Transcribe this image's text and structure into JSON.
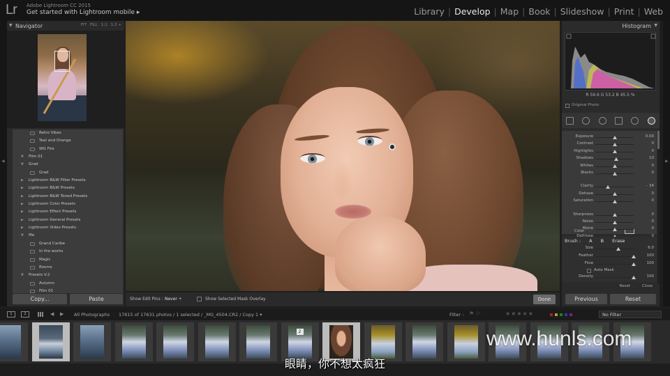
{
  "app": {
    "logo": "Lr",
    "name": "Adobe Lightroom CC 2015",
    "identity": "Get started with Lightroom mobile ▸"
  },
  "modules": [
    "Library",
    "Develop",
    "Map",
    "Book",
    "Slideshow",
    "Print",
    "Web"
  ],
  "active_module": "Develop",
  "navigator": {
    "title": "Navigator",
    "modes": [
      "FIT",
      "FILL",
      "1:1",
      "1:2 ÷"
    ]
  },
  "presets": [
    {
      "kind": "item",
      "label": "Retro Vibes"
    },
    {
      "kind": "item",
      "label": "Teal and Orange"
    },
    {
      "kind": "item",
      "label": "WG Fire"
    },
    {
      "kind": "folder",
      "open": true,
      "label": "Film 01"
    },
    {
      "kind": "folder",
      "open": true,
      "label": "Grad"
    },
    {
      "kind": "item",
      "label": "Grad"
    },
    {
      "kind": "folder",
      "open": false,
      "label": "Lightroom B&W Filter Presets"
    },
    {
      "kind": "folder",
      "open": false,
      "label": "Lightroom B&W Presets"
    },
    {
      "kind": "folder",
      "open": false,
      "label": "Lightroom B&W Toned Presets"
    },
    {
      "kind": "folder",
      "open": false,
      "label": "Lightroom Color Presets"
    },
    {
      "kind": "folder",
      "open": false,
      "label": "Lightroom Effect Presets"
    },
    {
      "kind": "folder",
      "open": false,
      "label": "Lightroom General Presets"
    },
    {
      "kind": "folder",
      "open": false,
      "label": "Lightroom Video Presets"
    },
    {
      "kind": "folder",
      "open": true,
      "label": "Me"
    },
    {
      "kind": "item",
      "label": "Grand Caribe"
    },
    {
      "kind": "item",
      "label": "In the works"
    },
    {
      "kind": "item",
      "label": "Magic"
    },
    {
      "kind": "item",
      "label": "Rooms"
    },
    {
      "kind": "folder",
      "open": true,
      "label": "Presets V.2"
    },
    {
      "kind": "item",
      "label": "Autumn"
    },
    {
      "kind": "item",
      "label": "Film 01"
    }
  ],
  "left_buttons": {
    "copy": "Copy...",
    "paste": "Paste"
  },
  "toolbar": {
    "edit_pins_label": "Show Edit Pins :",
    "edit_pins_value": "Never ÷",
    "mask_overlay_label": "Show Selected Mask Overlay",
    "done": "Done"
  },
  "histogram": {
    "title": "Histogram",
    "readout": "R  59.6  G  53.2  B  45.5 %",
    "original_photo": "Original Photo"
  },
  "adjustments": [
    {
      "label": "Exposure",
      "value": "0.00",
      "pos": 0.5
    },
    {
      "label": "Contrast",
      "value": "0",
      "pos": 0.5
    },
    {
      "label": "Highlights",
      "value": "0",
      "pos": 0.5
    },
    {
      "label": "Shadows",
      "value": "10",
      "pos": 0.55
    },
    {
      "label": "Whites",
      "value": "0",
      "pos": 0.5
    },
    {
      "label": "Blacks",
      "value": "0",
      "pos": 0.5
    },
    {
      "label": "Clarity",
      "value": "- 34",
      "pos": 0.33
    },
    {
      "label": "Dehaze",
      "value": "0",
      "pos": 0.5
    },
    {
      "label": "Saturation",
      "value": "0",
      "pos": 0.5
    },
    {
      "label": "Sharpness",
      "value": "0",
      "pos": 0.5
    },
    {
      "label": "Noise",
      "value": "0",
      "pos": 0.5
    },
    {
      "label": "Moiré",
      "value": "0",
      "pos": 0.5
    },
    {
      "label": "Defringe",
      "value": "0",
      "pos": 0.5
    }
  ],
  "color_label": "Color",
  "brush": {
    "label": "Brush :",
    "tabs": [
      "A",
      "B",
      "Erase"
    ],
    "sliders": [
      {
        "label": "Size",
        "value": "6.0",
        "pos": 0.6
      },
      {
        "label": "Feather",
        "value": "100",
        "pos": 1.0
      },
      {
        "label": "Flow",
        "value": "100",
        "pos": 1.0
      },
      {
        "label": "Density",
        "value": "100",
        "pos": 1.0
      }
    ],
    "auto_mask": "Auto Mask",
    "reset": "Reset",
    "close": "Close"
  },
  "right_buttons": {
    "previous": "Previous",
    "reset": "Reset"
  },
  "strip_bar": {
    "monitor_1": "1",
    "monitor_2": "2",
    "source": "All Photographs",
    "info": "17615 of 17631 photos / 1 selected / _MG_4504.CR2 / Copy 1 ▾",
    "filter_label": "Filter :",
    "filter_value": "No Filter",
    "stars": "★★★★★"
  },
  "filmstrip": [
    {
      "kind": "lake",
      "selected": false
    },
    {
      "kind": "boat",
      "selected": true
    },
    {
      "kind": "lake",
      "selected": false
    },
    {
      "kind": "dress",
      "selected": false
    },
    {
      "kind": "dress",
      "selected": false
    },
    {
      "kind": "dress",
      "selected": false
    },
    {
      "kind": "dress",
      "selected": false
    },
    {
      "kind": "dress",
      "selected": false,
      "badge": "2"
    },
    {
      "kind": "portrait",
      "selected": true
    },
    {
      "kind": "field",
      "selected": false
    },
    {
      "kind": "dress",
      "selected": false
    },
    {
      "kind": "field",
      "selected": false
    },
    {
      "kind": "dress",
      "selected": false
    },
    {
      "kind": "dress",
      "selected": false
    },
    {
      "kind": "dress",
      "selected": false
    },
    {
      "kind": "dress",
      "selected": false
    }
  ],
  "subtitle": "眼睛，你不想太疯狂",
  "watermark": "www.hunls.com",
  "colors": {
    "active_module": "#e8e8e8",
    "selected_frame": "#bcbcbc",
    "panel": "#2b2b2b"
  },
  "icons": [
    "triangle-collapse-icon",
    "grid-view-icon",
    "back-arrow-icon",
    "forward-arrow-icon",
    "flag-icon",
    "star-icon",
    "edit-pin-icon"
  ]
}
